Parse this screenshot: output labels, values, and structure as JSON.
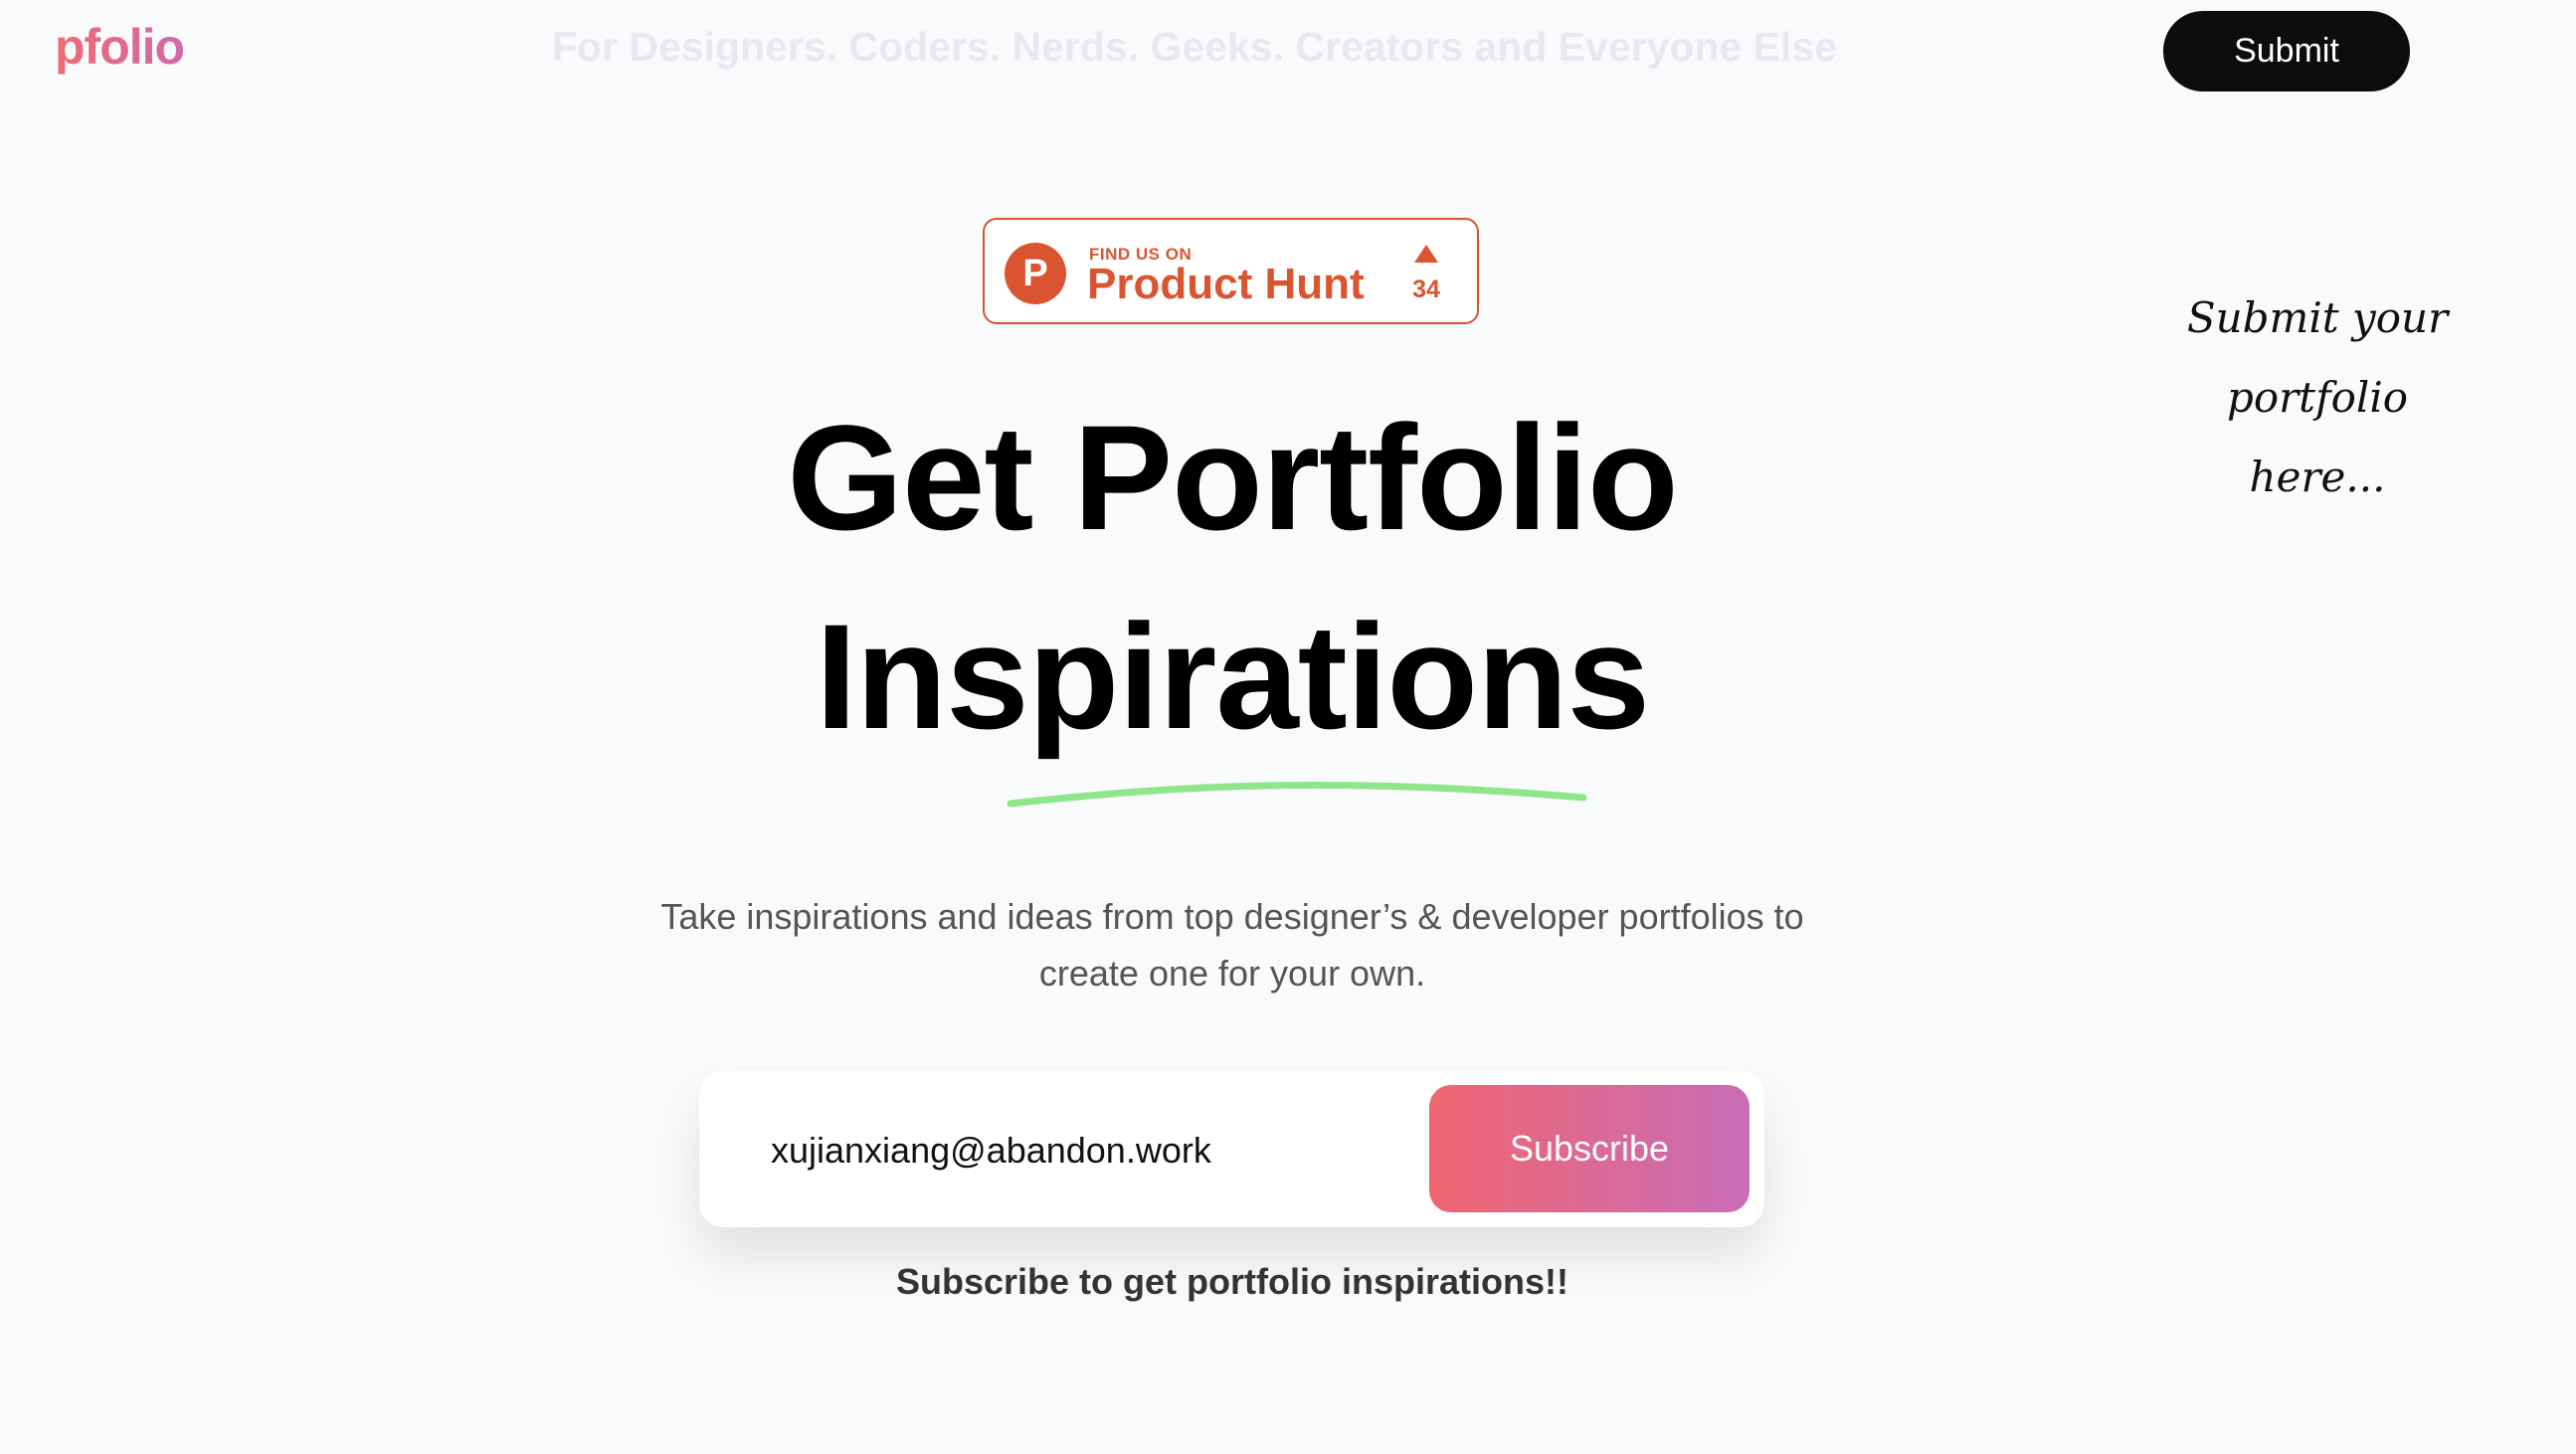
{
  "header": {
    "logo": "pfolio",
    "tagline": "For Designers. Coders. Nerds. Geeks. Creators and Everyone Else",
    "submit_label": "Submit"
  },
  "product_hunt": {
    "find_label": "FIND US ON",
    "name": "Product Hunt",
    "upvote_icon": "triangle-up-icon",
    "upvotes": "34"
  },
  "hero": {
    "line1": "Get Portfolio",
    "line2": "Inspirations",
    "underline_color": "#8ee68a",
    "description": "Take inspirations and ideas from top designer’s & developer portfolios to create one for your own."
  },
  "subscribe": {
    "email_value": "xujianxiang@abandon.work",
    "button_label": "Subscribe",
    "caption": "Subscribe to get portfolio inspirations!!"
  },
  "side_note": {
    "line1": "Submit your",
    "line2": "portfolio",
    "line3": "here..."
  },
  "colors": {
    "brand_gradient": [
      "#ef6a72",
      "#d06aa8"
    ],
    "product_hunt": "#da552f",
    "submit_bg": "#0d0d0d"
  }
}
